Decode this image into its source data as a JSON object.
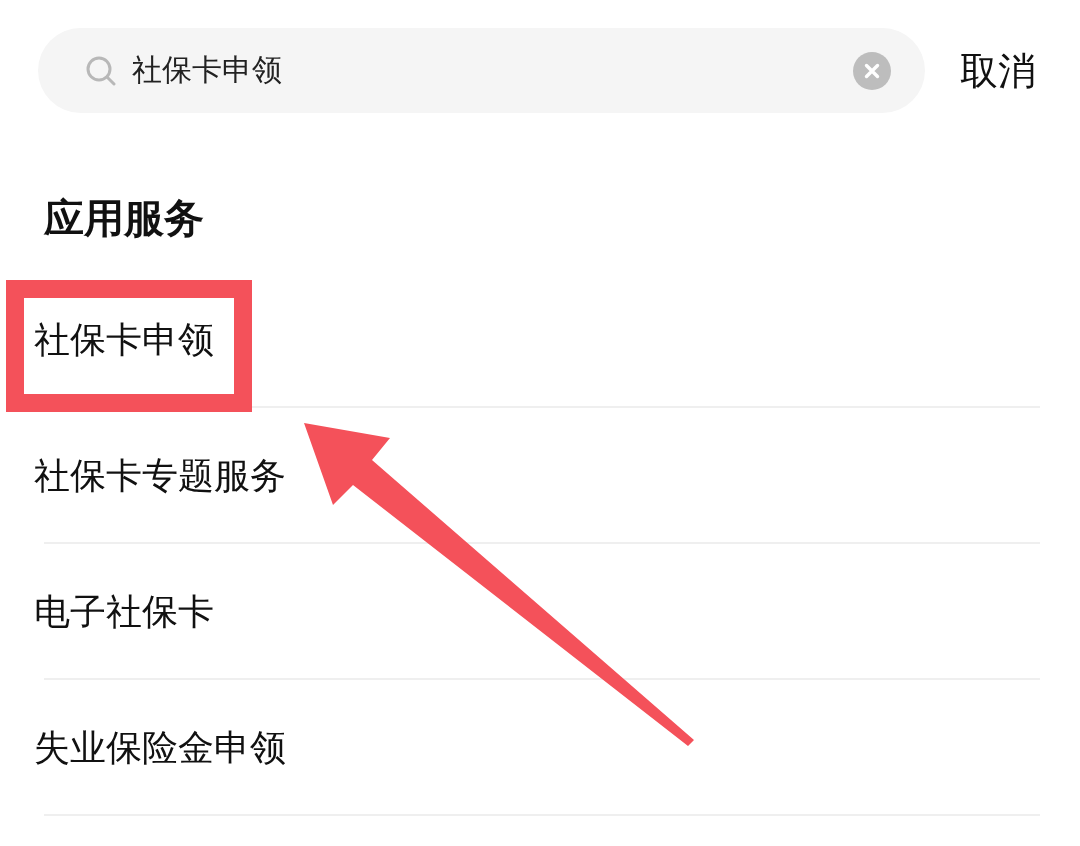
{
  "search": {
    "value": "社保卡申领",
    "cancel": "取消"
  },
  "section": {
    "title": "应用服务",
    "items": [
      {
        "label": "社保卡申领",
        "highlighted": true
      },
      {
        "label": "社保卡专题服务",
        "highlighted": false
      },
      {
        "label": "电子社保卡",
        "highlighted": false
      },
      {
        "label": "失业保险金申领",
        "highlighted": false
      }
    ]
  },
  "pointer_arrow": true
}
